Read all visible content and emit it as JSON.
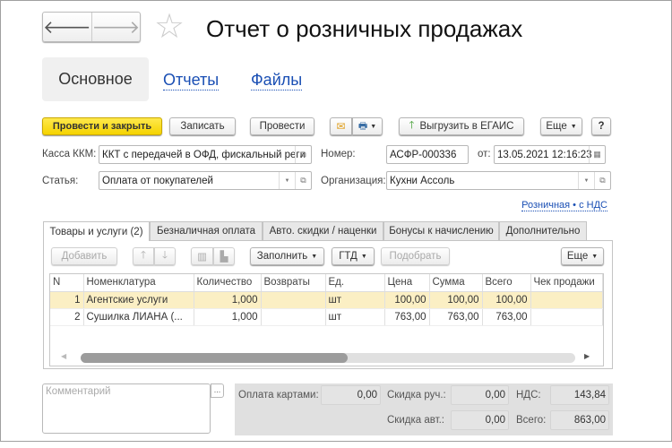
{
  "window": {
    "title": "Отчет о розничных продажах"
  },
  "nav": {
    "back": "back",
    "forward": "forward"
  },
  "sections": [
    {
      "label": "Основное"
    },
    {
      "label": "Отчеты"
    },
    {
      "label": "Файлы"
    }
  ],
  "toolbar": {
    "post_close": "Провести и закрыть",
    "save": "Записать",
    "post": "Провести",
    "egais": "Выгрузить в ЕГАИС",
    "more": "Еще",
    "help": "?"
  },
  "form": {
    "kkm_label": "Касса ККМ:",
    "kkm_value": "ККТ с передачей в ОФД, фискальный реги",
    "number_label": "Номер:",
    "number_value": "АСФР-000336",
    "date_label": "от:",
    "date_value": "13.05.2021 12:16:23",
    "article_label": "Статья:",
    "article_value": "Оплата от покупателей",
    "org_label": "Организация:",
    "org_value": "Кухни Ассоль",
    "price_type_link": "Розничная • с НДС"
  },
  "tabs": [
    {
      "label": "Товары и услуги (2)"
    },
    {
      "label": "Безналичная оплата"
    },
    {
      "label": "Авто. скидки / наценки"
    },
    {
      "label": "Бонусы к начислению"
    },
    {
      "label": "Дополнительно"
    }
  ],
  "table_toolbar": {
    "add": "Добавить",
    "fill": "Заполнить",
    "gtd": "ГТД",
    "pick": "Подобрать",
    "more": "Еще"
  },
  "table": {
    "columns": [
      "N",
      "Номенклатура",
      "Количество",
      "Возвраты",
      "Ед.",
      "Цена",
      "Сумма",
      "Всего",
      "Чек продажи"
    ],
    "rows": [
      {
        "n": "1",
        "item": "Агентские услуги",
        "qty": "1,000",
        "returns": "",
        "unit": "шт",
        "price": "100,00",
        "sum": "100,00",
        "total": "100,00",
        "receipt": ""
      },
      {
        "n": "2",
        "item": "Сушилка ЛИАНА (...",
        "qty": "1,000",
        "returns": "",
        "unit": "шт",
        "price": "763,00",
        "sum": "763,00",
        "total": "763,00",
        "receipt": ""
      }
    ],
    "scroll_position": 0.45
  },
  "comment": {
    "placeholder": "Комментарий"
  },
  "totals": {
    "card_label": "Оплата картами:",
    "card_value": "0,00",
    "manual_disc_label": "Скидка руч.:",
    "manual_disc_value": "0,00",
    "vat_label": "НДС:",
    "vat_value": "143,84",
    "auto_disc_label": "Скидка авт.:",
    "auto_disc_value": "0,00",
    "total_label": "Всего:",
    "total_value": "863,00"
  },
  "colors": {
    "accent_yellow": "#f5d300",
    "link": "#1a4fb4",
    "row_highlight": "#fbefc4",
    "summary_bg": "#e0e0e0"
  }
}
